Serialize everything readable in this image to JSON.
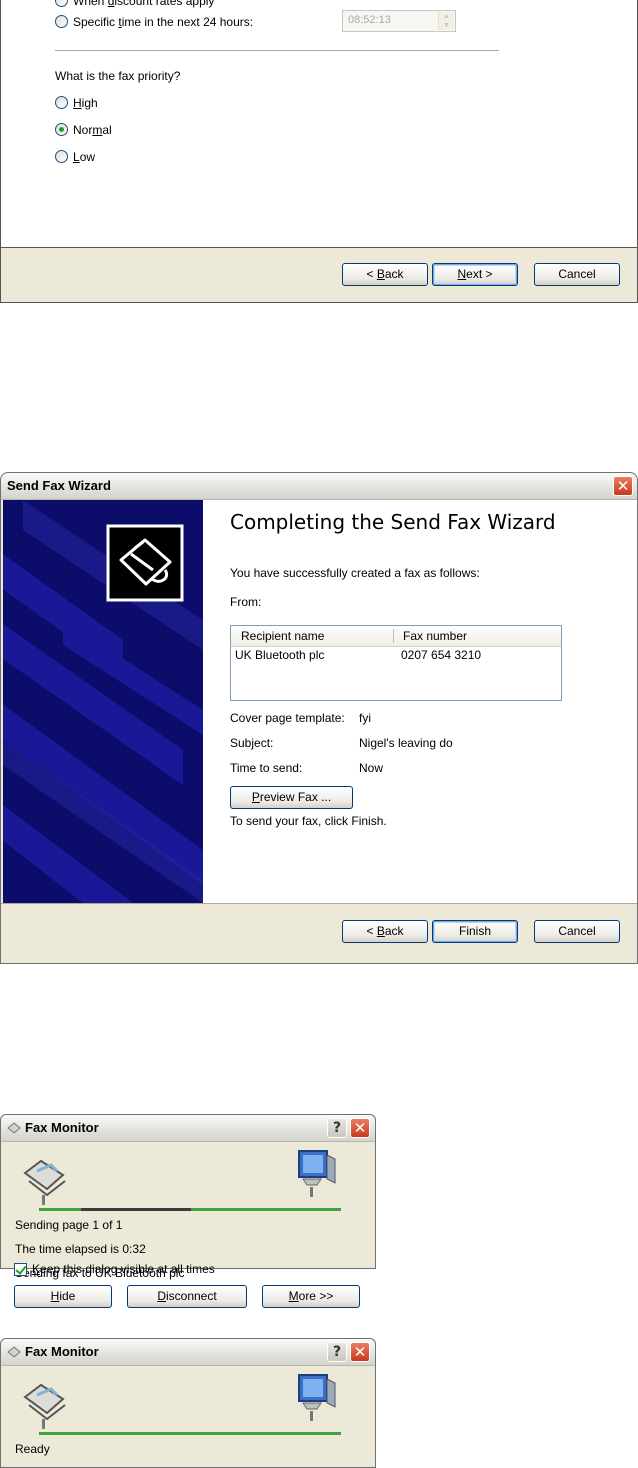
{
  "dialog1": {
    "options_top": [
      {
        "label_pre": "When ",
        "label_u": "d",
        "label_post": "iscount rates apply",
        "checked": false
      },
      {
        "label_pre": "Specific ",
        "label_u": "t",
        "label_post": "ime in the next 24 hours:",
        "checked": false
      }
    ],
    "time_value": "08:52:13",
    "priority_question": "What is the fax priority?",
    "priority_options": [
      {
        "label_pre": "",
        "label_u": "H",
        "label_post": "igh",
        "checked": false
      },
      {
        "label_pre": "Nor",
        "label_u": "m",
        "label_post": "al",
        "checked": true
      },
      {
        "label_pre": "",
        "label_u": "L",
        "label_post": "ow",
        "checked": false
      }
    ],
    "buttons": {
      "back_pre": "< ",
      "back_u": "B",
      "back_post": "ack",
      "next_pre": "",
      "next_u": "N",
      "next_post": "ext >",
      "cancel": "Cancel"
    }
  },
  "dialog2": {
    "title": "Send Fax Wizard",
    "close_glyph": "✕",
    "heading": "Completing the Send Fax Wizard",
    "intro": "You have successfully created a fax as follows:",
    "from_label": "From:",
    "list": {
      "columns": [
        "Recipient name",
        "Fax number"
      ],
      "rows": [
        [
          "UK Bluetooth plc",
          "0207 654 3210"
        ]
      ]
    },
    "cover_label": "Cover page template:",
    "cover_value": "fyi",
    "subject_label": "Subject:",
    "subject_value": "Nigel's leaving do",
    "time_label": "Time to send:",
    "time_value": "Now",
    "preview_pre": "",
    "preview_u": "P",
    "preview_post": "review Fax ...",
    "finish_hint": "To send your fax, click Finish.",
    "buttons": {
      "back_pre": "< ",
      "back_u": "B",
      "back_post": "ack",
      "finish": "Finish",
      "cancel": "Cancel"
    }
  },
  "monitor1": {
    "title": "Fax Monitor",
    "help_glyph": "?",
    "close_glyph": "✕",
    "status_lines": [
      "Sending page 1 of 1",
      "The time elapsed is 0:32",
      "Sending fax to UK Bluetooth plc"
    ],
    "progress": 0.55,
    "keep_visible_u": "K",
    "keep_visible_post": "eep this dialog visible at all times",
    "keep_visible_checked": true,
    "buttons": {
      "hide_u": "H",
      "hide_post": "ide",
      "disconnect_u": "D",
      "disconnect_post": "isconnect",
      "more_u": "M",
      "more_post": "ore >>"
    }
  },
  "monitor2": {
    "title": "Fax Monitor",
    "help_glyph": "?",
    "close_glyph": "✕",
    "status": "Ready"
  },
  "colors": {
    "wizard_side": "#0c0c6a",
    "xp_face": "#ece9d8",
    "link_line": "#3fa33f"
  }
}
